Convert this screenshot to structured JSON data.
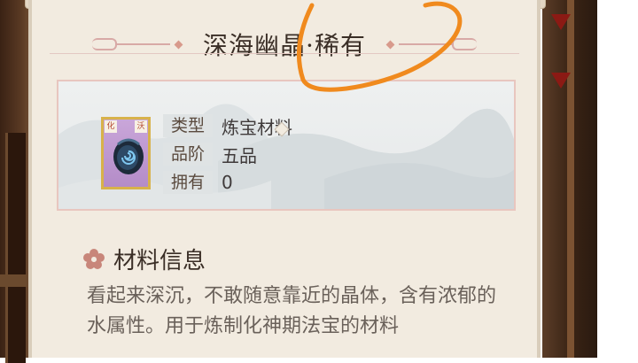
{
  "item": {
    "title": "深海幽晶·稀有",
    "icon": "dark-blue-spiral-shell",
    "icon_tags": [
      "化",
      "沃"
    ]
  },
  "attributes": [
    {
      "label": "类型",
      "value": "炼宝材料"
    },
    {
      "label": "品阶",
      "value": "五品"
    },
    {
      "label": "拥有",
      "value": "0"
    }
  ],
  "section": {
    "title": "材料信息",
    "description": "看起来深沉，不敢随意靠近的晶体，含有浓郁的水属性。用于炼制化神期法宝的材料"
  },
  "colors": {
    "panel": "#f2ebe0",
    "frame_gold": "#d8b24a",
    "icon_bg": "#b48cc8",
    "annotation": "#f08a1e"
  }
}
